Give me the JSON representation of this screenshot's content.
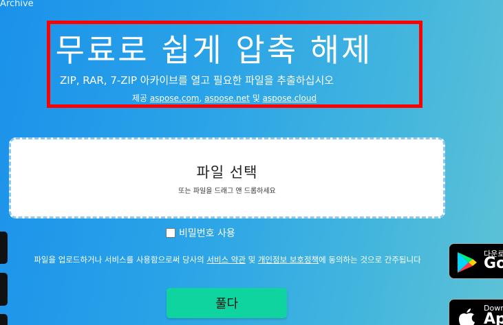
{
  "header": {
    "archive_label": "Archive"
  },
  "hero": {
    "title": "무료로 쉽게 압축 해제",
    "subtitle": "ZIP, RAR, 7-ZIP 아카이브를 열고 필요한 파일을 추출하십시오",
    "credit_prefix": "제공",
    "links": [
      "aspose.com",
      "aspose.net",
      "aspose.cloud"
    ],
    "separator": ",",
    "conjunction": "및"
  },
  "dropzone": {
    "title": "파일 선택",
    "hint": "또는 파일을 드래그 앤 드롭하세요"
  },
  "password": {
    "label": "비밀번호 사용",
    "checked": false
  },
  "terms": {
    "prefix": "파일을 업로드하거나 서비스를 사용함으로써 당사의",
    "terms_link": "서비스 약관",
    "and": "및",
    "privacy_link": "개인정보 보호정책",
    "suffix": "에 동의하는 것으로 간주됩니다"
  },
  "action": {
    "unzip_label": "풀다"
  },
  "store_badges": [
    {
      "icon": "google-play-icon",
      "small": "다운로",
      "big": "Go"
    },
    {
      "icon": "apple-icon",
      "small": "Down",
      "big": "Ap"
    }
  ],
  "colors": {
    "accent_button": "#0fd4a0",
    "highlight_border": "#ff0000",
    "dropzone_border": "#8cc9ec"
  }
}
